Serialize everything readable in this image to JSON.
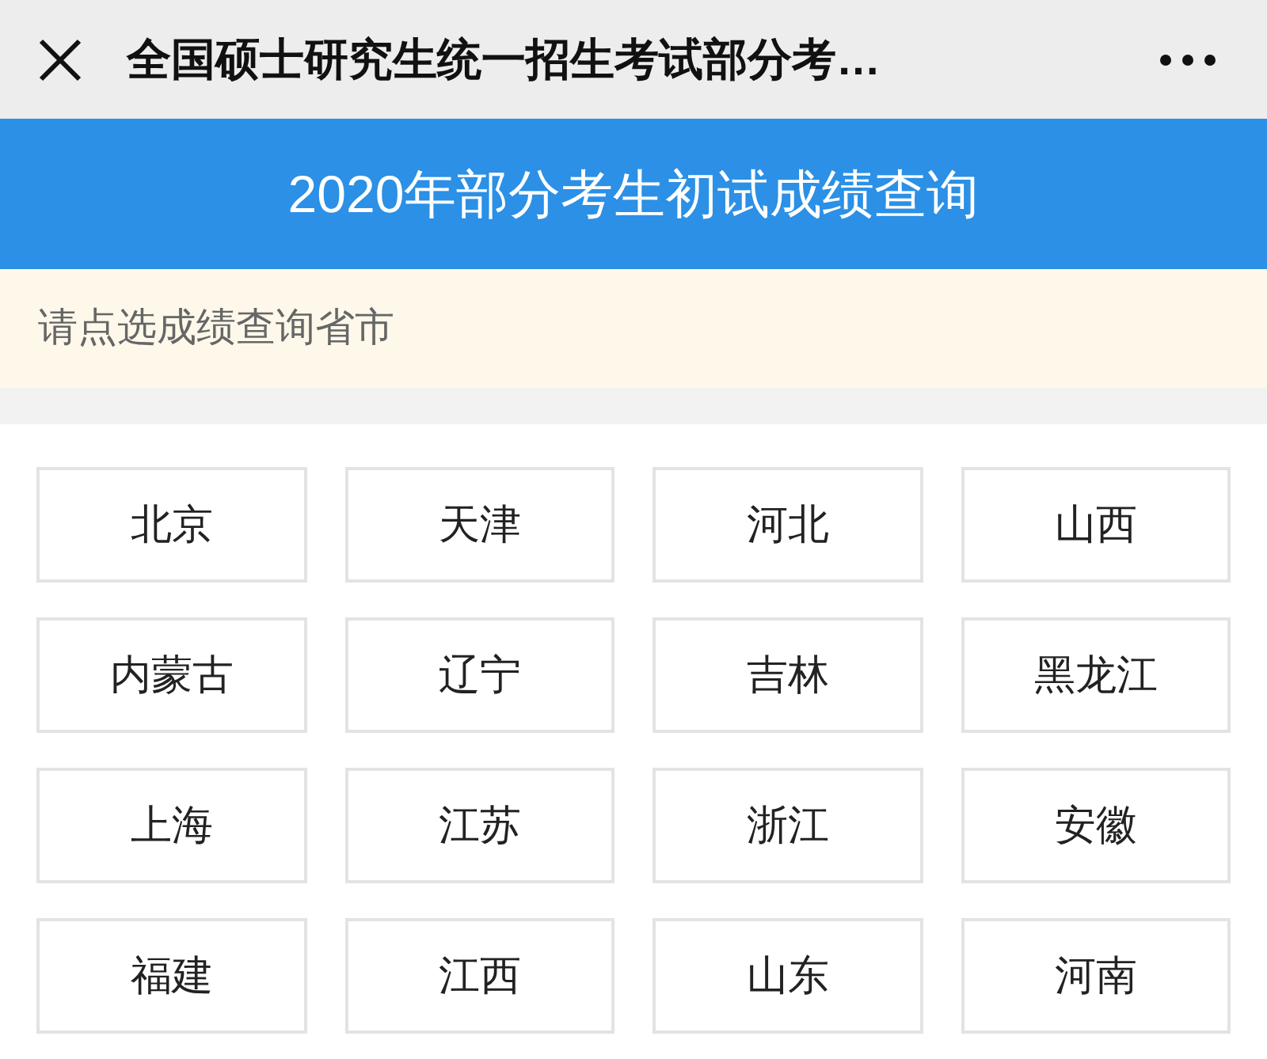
{
  "top_bar": {
    "title": "全国硕士研究生统一招生考试部分考…"
  },
  "banner": {
    "title": "2020年部分考生初试成绩查询"
  },
  "hint": "请点选成绩查询省市",
  "provinces": [
    "北京",
    "天津",
    "河北",
    "山西",
    "内蒙古",
    "辽宁",
    "吉林",
    "黑龙江",
    "上海",
    "江苏",
    "浙江",
    "安徽",
    "福建",
    "江西",
    "山东",
    "河南"
  ]
}
